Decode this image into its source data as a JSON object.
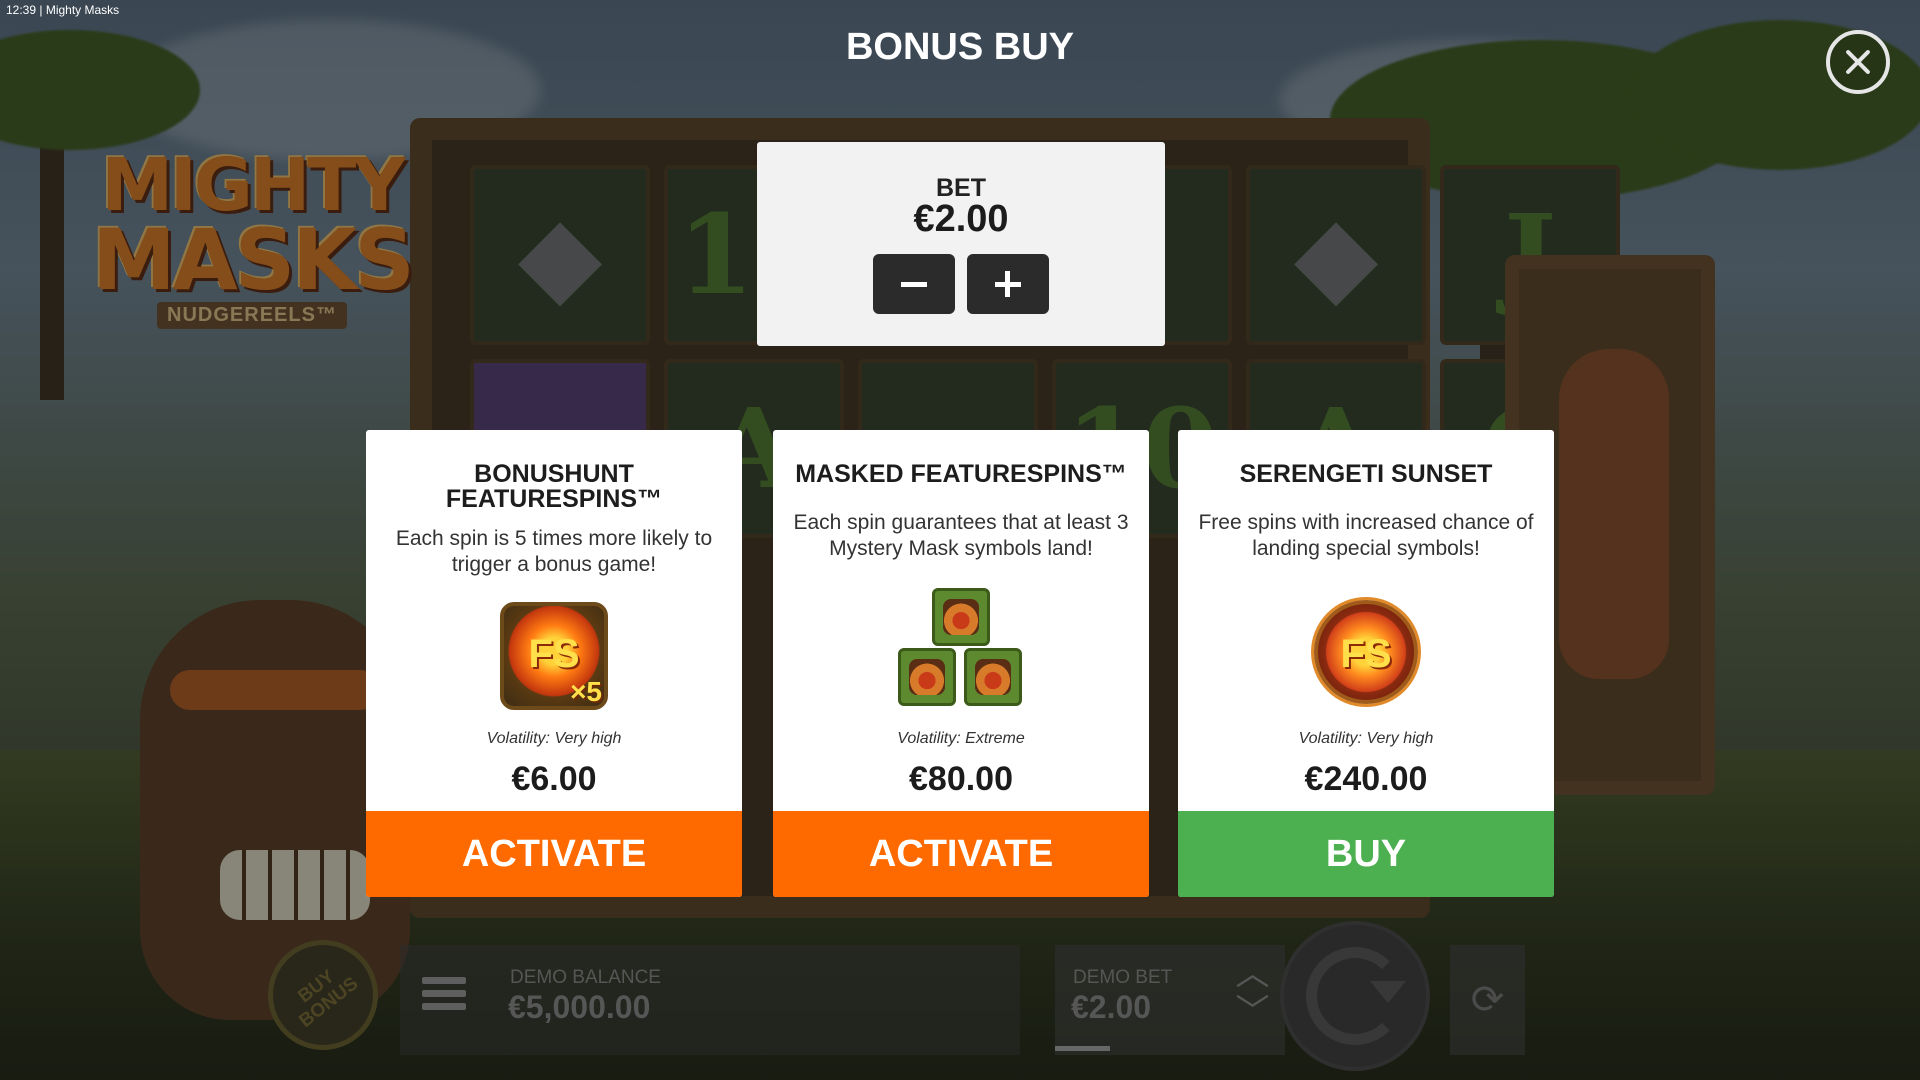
{
  "status_bar": {
    "time": "12:39",
    "app": "Mighty Masks"
  },
  "header": {
    "title": "BONUS BUY"
  },
  "game_logo": {
    "line1": "MIGHTY",
    "line2": "MASKS",
    "line3": "NUDGEREELS™"
  },
  "bet": {
    "label": "BET",
    "value": "€2.00",
    "decrease_icon": "minus-icon",
    "increase_icon": "plus-icon"
  },
  "cards": [
    {
      "title": "BONUSHUNT FEATURESPINS™",
      "description": "Each spin is 5 times more likely to trigger a bonus game!",
      "icon": "fs-x5-icon",
      "icon_text": "FS",
      "icon_multiplier": "×5",
      "volatility": "Volatility: Very high",
      "price": "€6.00",
      "button": "ACTIVATE",
      "button_color": "#ff6a00"
    },
    {
      "title": "MASKED FEATURESPINS™",
      "description": "Each spin guarantees that at least 3 Mystery Mask symbols land!",
      "icon": "mystery-mask-icon",
      "volatility": "Volatility: Extreme",
      "price": "€80.00",
      "button": "ACTIVATE",
      "button_color": "#ff6a00"
    },
    {
      "title": "SERENGETI SUNSET",
      "description": "Free spins with increased chance of landing special symbols!",
      "icon": "fs-sunset-icon",
      "icon_text": "FS",
      "volatility": "Volatility: Very high",
      "price": "€240.00",
      "button": "BUY",
      "button_color": "#4caf50"
    }
  ],
  "hud": {
    "balance_label": "DEMO BALANCE",
    "balance_value": "€5,000.00",
    "bet_label": "DEMO BET",
    "bet_value": "€2.00",
    "buy_bonus_label": "BUY BONUS"
  },
  "reel_symbols": [
    "10",
    "J",
    "A",
    "10",
    "A",
    "Q"
  ],
  "colors": {
    "activate": "#ff6a00",
    "buy": "#4caf50",
    "overlay_text": "#ffffff"
  }
}
